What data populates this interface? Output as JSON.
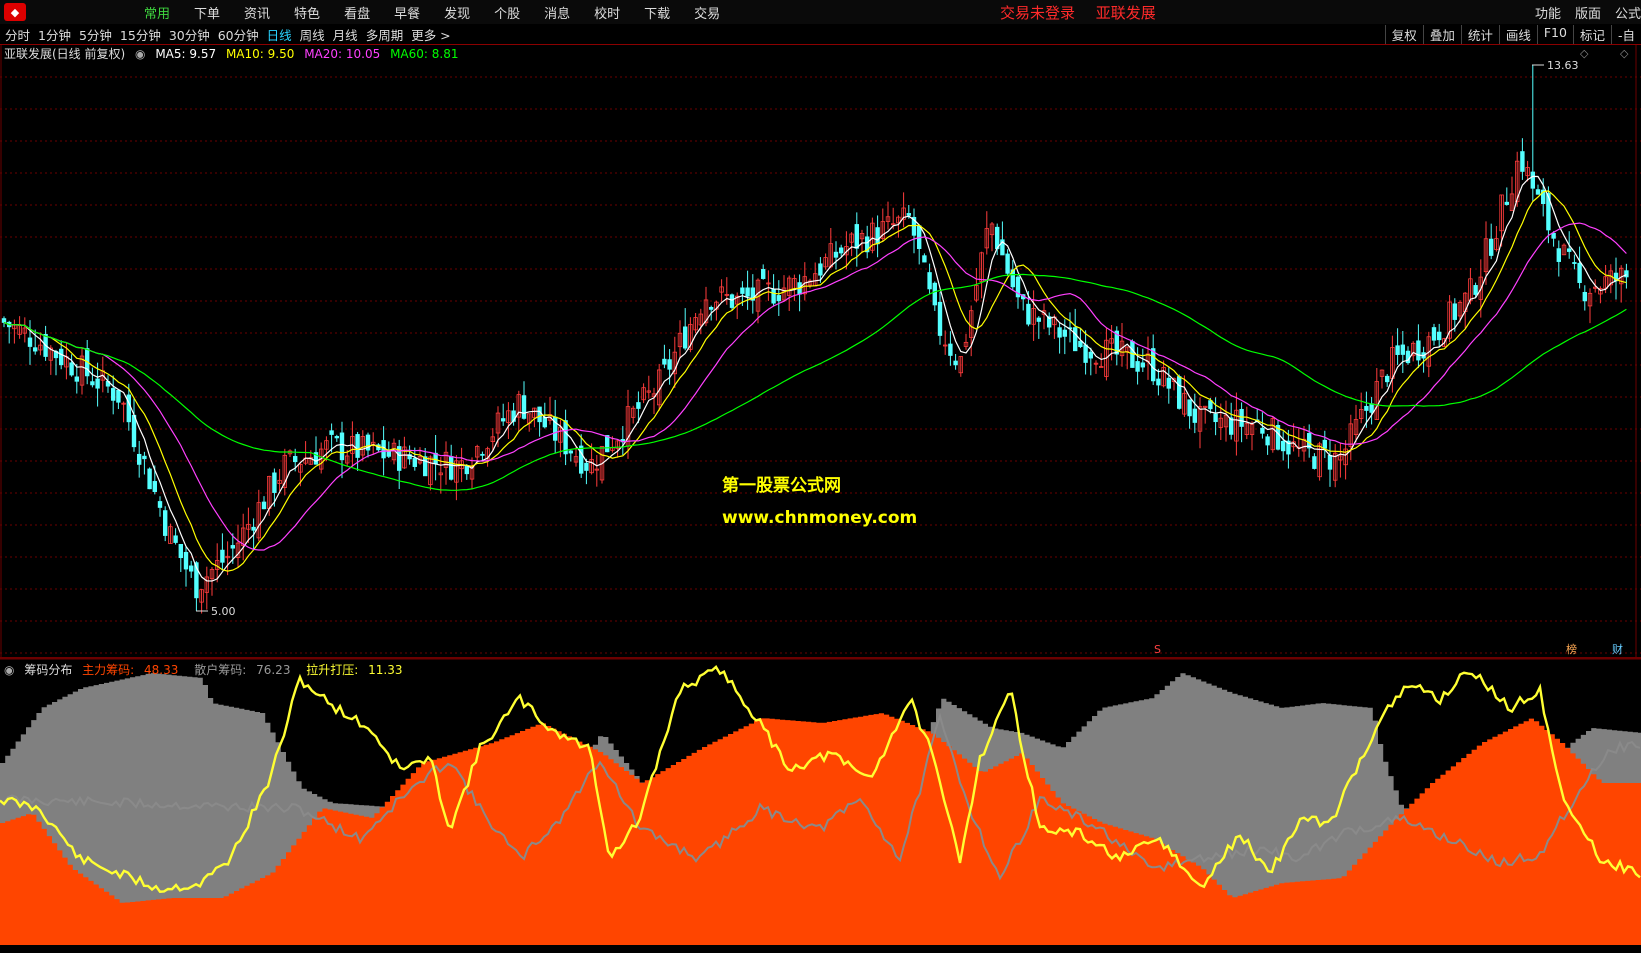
{
  "menubar": {
    "items": [
      "常用",
      "下单",
      "资讯",
      "特色",
      "看盘",
      "早餐",
      "发现",
      "个股",
      "消息",
      "校时",
      "下载",
      "交易"
    ],
    "active": "常用",
    "status_text": "交易未登录",
    "stock_title": "亚联发展",
    "right": [
      "功能",
      "版面",
      "公式"
    ]
  },
  "toolbar": {
    "periods": [
      "分时",
      "1分钟",
      "5分钟",
      "15分钟",
      "30分钟",
      "60分钟",
      "日线",
      "周线",
      "月线",
      "多周期",
      "更多 >"
    ],
    "active": "日线",
    "right": [
      "复权",
      "叠加",
      "统计",
      "画线",
      "F10",
      "标记",
      "-自"
    ]
  },
  "main_chart": {
    "title": "亚联发展(日线 前复权)",
    "ma5_label": "MA5: 9.57",
    "ma10_label": "MA10: 9.50",
    "ma20_label": "MA20: 10.05",
    "ma60_label": "MA60: 8.81",
    "high_label": "13.63",
    "low_label": "5.00",
    "watermark_cn": "第一股票公式网",
    "watermark_url": "www.chnmoney.com",
    "badge_s": "S",
    "badge_bang": "榜",
    "badge_cai": "财",
    "colors": {
      "up": "#ff3c3c",
      "down": "#54ffff",
      "ma5": "#ffffff",
      "ma10": "#ffff00",
      "ma20": "#ff40ff",
      "ma60": "#00ff00",
      "grid": "#6b0000"
    }
  },
  "indicator": {
    "title": "筹码分布",
    "main_label": "主力筹码:",
    "main_value": "48.33",
    "retail_label": "散户筹码:",
    "retail_value": "76.23",
    "lift_label": "拉升打压:",
    "lift_value": "11.33",
    "colors": {
      "main": "#ff4500",
      "retail": "#808080",
      "lift": "#ffff33"
    }
  },
  "chart_data": [
    {
      "type": "line",
      "title": "亚联发展(日线 前复权)",
      "note_levels": {
        "max": 13.63,
        "min": 5.0
      },
      "series": [
        {
          "name": "MA5",
          "last": 9.57
        },
        {
          "name": "MA10",
          "last": 9.5
        },
        {
          "name": "MA20",
          "last": 10.05
        },
        {
          "name": "MA60",
          "last": 8.81
        }
      ]
    },
    {
      "type": "area",
      "title": "筹码分布",
      "series": [
        {
          "name": "主力筹码",
          "last": 48.33
        },
        {
          "name": "散户筹码",
          "last": 76.23
        },
        {
          "name": "拉升打压",
          "last": 11.33
        }
      ]
    }
  ]
}
